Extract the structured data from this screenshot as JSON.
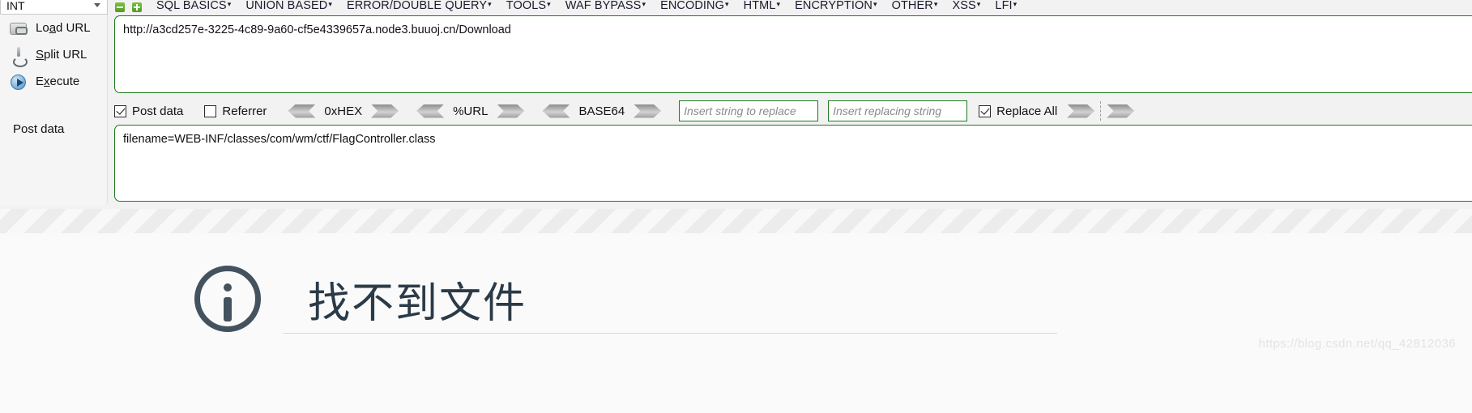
{
  "hackbar": {
    "type_selector": {
      "value": "INT",
      "icon": "chevron-down-icon"
    },
    "panel_buttons": {
      "minus": "minus-button",
      "plus": "plus-button"
    },
    "menus": [
      {
        "label": "SQL BASICS",
        "caret": "▾"
      },
      {
        "label": "UNION BASED",
        "caret": "▾"
      },
      {
        "label": "ERROR/DOUBLE QUERY",
        "caret": "▾"
      },
      {
        "label": "TOOLS",
        "caret": "▾"
      },
      {
        "label": "WAF BYPASS",
        "caret": "▾"
      },
      {
        "label": "ENCODING",
        "caret": "▾"
      },
      {
        "label": "HTML",
        "caret": "▾"
      },
      {
        "label": "ENCRYPTION",
        "caret": "▾"
      },
      {
        "label": "OTHER",
        "caret": "▾"
      },
      {
        "label": "XSS",
        "caret": "▾"
      },
      {
        "label": "LFI",
        "caret": "▾"
      }
    ],
    "actions": [
      {
        "label_pre": "Lo",
        "label_key": "a",
        "label_post": "d URL",
        "icon": "load-url-icon"
      },
      {
        "label_pre": "",
        "label_key": "S",
        "label_post": "plit URL",
        "icon": "split-url-icon"
      },
      {
        "label_pre": "E",
        "label_key": "x",
        "label_post": "ecute",
        "icon": "execute-icon"
      }
    ],
    "url_field": {
      "value": "http://a3cd257e-3225-4c89-9a60-cf5e4339657a.node3.buuoj.cn/Download"
    },
    "options": {
      "post_data": {
        "label": "Post data",
        "checked": true
      },
      "referrer": {
        "label": "Referrer",
        "checked": false
      },
      "encoders": [
        {
          "label": "0xHEX"
        },
        {
          "label": "%URL"
        },
        {
          "label": "BASE64"
        }
      ],
      "replace_search": {
        "placeholder": "Insert string to replace",
        "value": ""
      },
      "replace_with": {
        "placeholder": "Insert replacing string",
        "value": ""
      },
      "replace_all": {
        "label": "Replace All",
        "checked": true
      }
    },
    "post_data": {
      "label": "Post data",
      "value": "filename=WEB-INF/classes/com/wm/ctf/FlagController.class"
    }
  },
  "page": {
    "error_icon": "info-circle-icon",
    "error_text": "找不到文件",
    "watermark": "https://blog.csdn.net/qq_42812036"
  },
  "colors": {
    "field_border_green": "#1c7a1c",
    "error_text": "#2b3a47",
    "panel_bg": "#f2f2f2"
  }
}
